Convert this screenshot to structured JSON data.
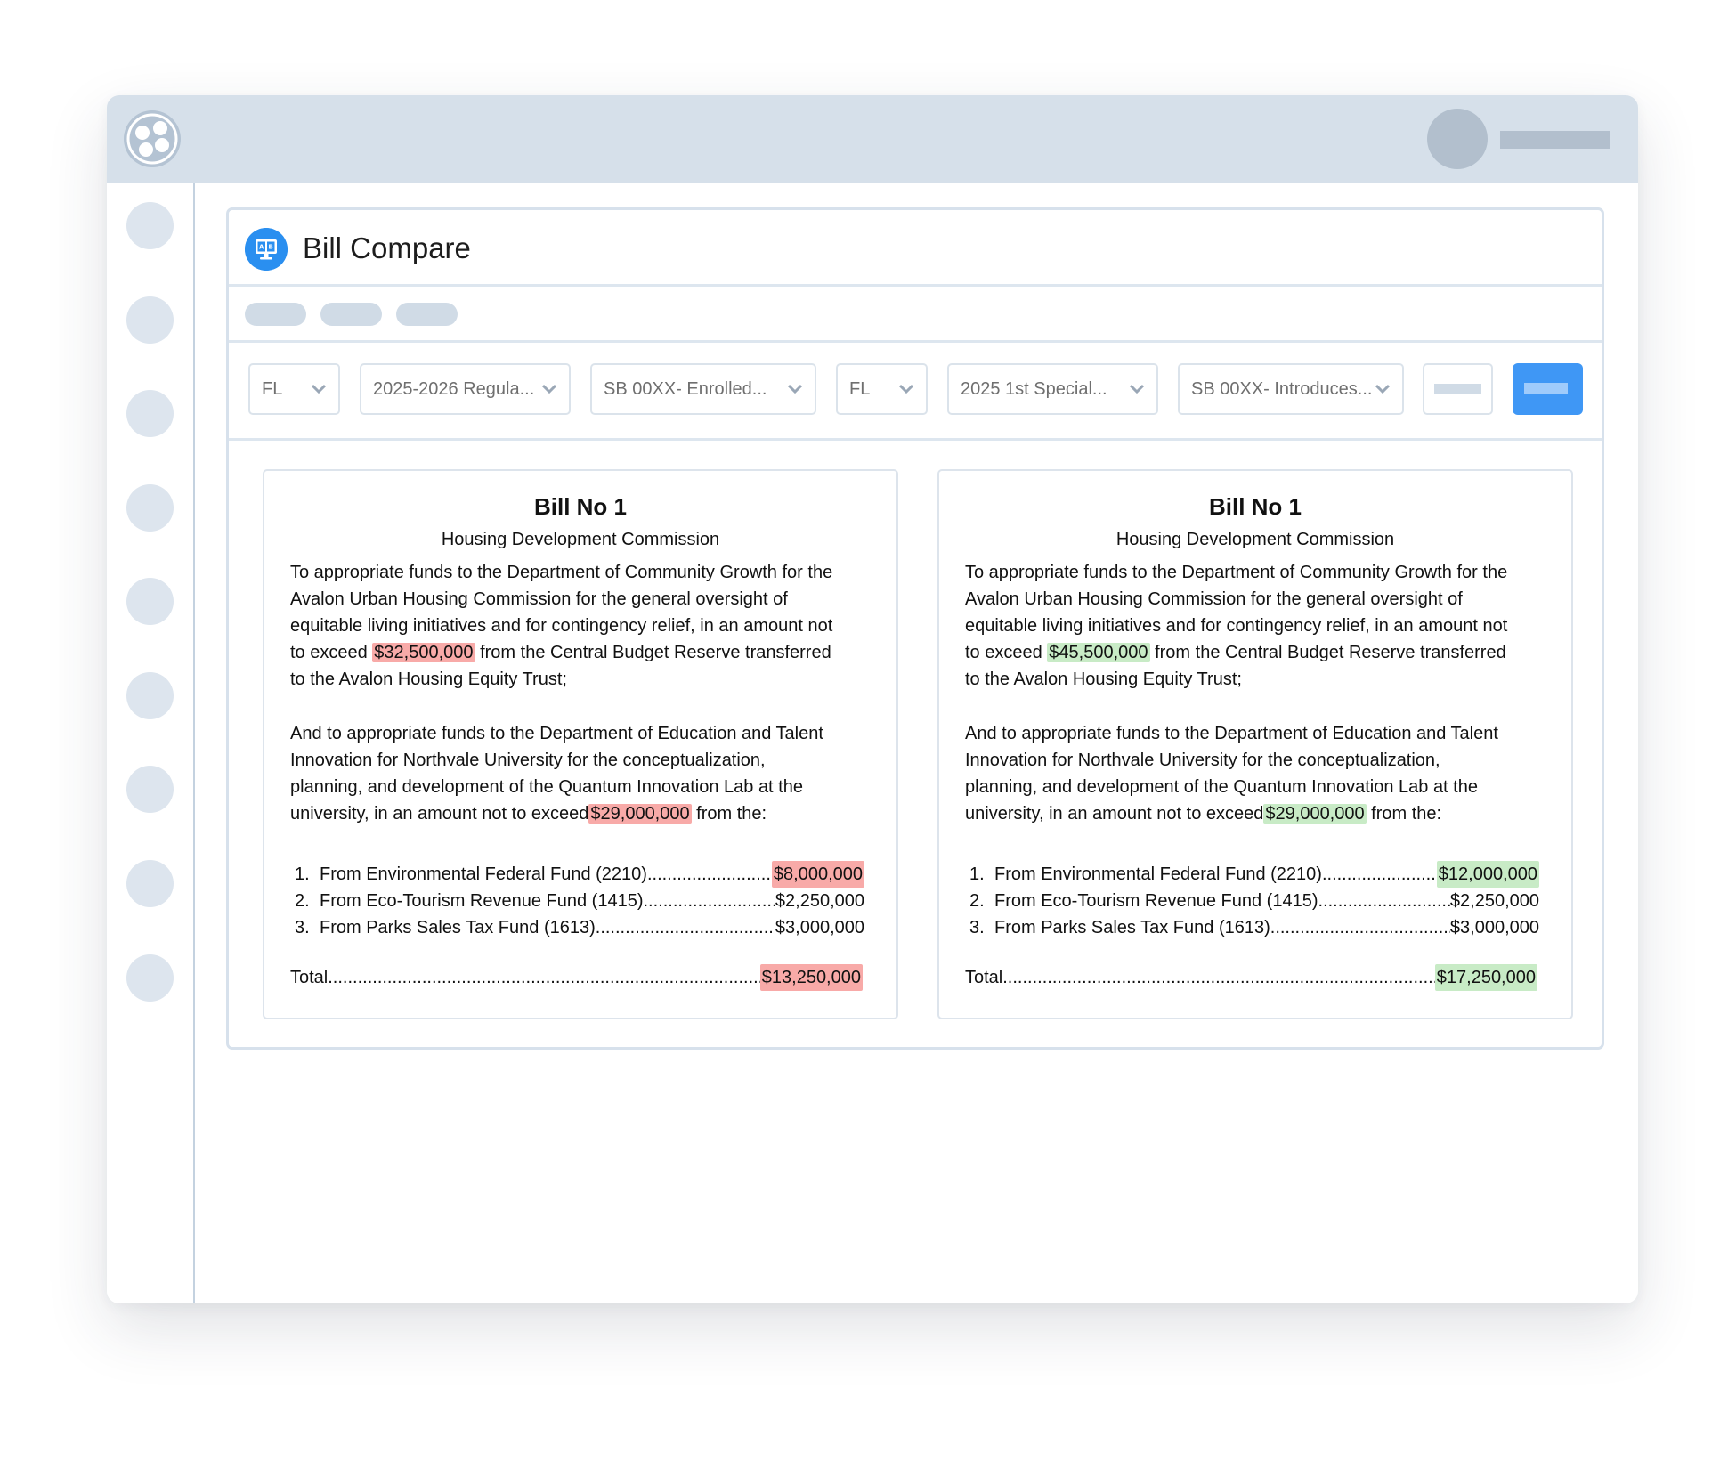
{
  "header": {
    "logo_icon": "brand-logo-icon",
    "avatar_icon": "user-avatar-icon"
  },
  "sidebar": {
    "items": 9
  },
  "panel": {
    "title": "Bill Compare",
    "icon": "compare-monitor-icon"
  },
  "filters": {
    "left": {
      "state": "FL",
      "session": "2025-2026 Regula...",
      "bill": "SB 00XX- Enrolled..."
    },
    "right": {
      "state": "FL",
      "session": "2025 1st Special...",
      "bill": "SB 00XX- Introduces..."
    }
  },
  "colors": {
    "removed_highlight": "#f8aaa8",
    "added_highlight": "#c8ebc6",
    "primary": "#3f97f5",
    "topbar": "#d6e0ea"
  },
  "left_doc": {
    "title": "Bill No 1",
    "subtitle": "Housing Development Commission",
    "p1": {
      "l1": "To appropriate funds to the Department of Community Growth for the",
      "l2": "Avalon Urban Housing Commission for the general oversight of",
      "l3": "equitable living initiatives and for contingency relief, in an amount not",
      "l4a": "to exceed ",
      "l4_amount": "$32,500,000",
      "l4b": " from the Central Budget Reserve transferred",
      "l5": "to the Avalon Housing Equity Trust;"
    },
    "p2": {
      "l1": "And to appropriate funds to the Department of Education and Talent",
      "l2": "Innovation for Northvale University for the conceptualization,",
      "l3": "planning, and development of the Quantum Innovation Lab at the",
      "l4a": "university, in an amount not to exceed",
      "l4_amount": "$29,000,000",
      "l4b": " from the:"
    },
    "items": [
      {
        "num": "1.",
        "label": "From Environmental Federal Fund (2210) ",
        "amount": "$8,000,000"
      },
      {
        "num": "2.",
        "label": "From Eco-Tourism Revenue Fund (1415)",
        "amount": "$2,250,000"
      },
      {
        "num": "3.",
        "label": "From Parks Sales Tax Fund (1613) ",
        "amount": "$3,000,000"
      }
    ],
    "total": {
      "label": "Total ",
      "amount": "$13,250,000"
    }
  },
  "right_doc": {
    "title": "Bill No 1",
    "subtitle": "Housing Development Commission",
    "p1": {
      "l1": "To appropriate funds to the Department of Community Growth for the",
      "l2": "Avalon Urban Housing Commission for the general oversight of",
      "l3": "equitable living initiatives and for contingency relief, in an amount not",
      "l4a": "to exceed ",
      "l4_amount": "$45,500,000",
      "l4b": " from the Central Budget Reserve transferred",
      "l5": "to the Avalon Housing Equity Trust;"
    },
    "p2": {
      "l1": "And to appropriate funds to the Department of Education and Talent",
      "l2": "Innovation for Northvale University for the conceptualization,",
      "l3": "planning, and development of the Quantum Innovation Lab at the",
      "l4a": "university, in an amount not to exceed",
      "l4_amount": "$29,000,000",
      "l4b": " from the:"
    },
    "items": [
      {
        "num": "1.",
        "label": "From Environmental Federal Fund (2210) ",
        "amount": "$12,000,000"
      },
      {
        "num": "2.",
        "label": "From Eco-Tourism Revenue Fund (1415)",
        "amount": "$2,250,000"
      },
      {
        "num": "3.",
        "label": "From Parks Sales Tax Fund (1613) ",
        "amount": "$3,000,000"
      }
    ],
    "total": {
      "label": "Total ",
      "amount": "$17,250,000"
    }
  }
}
